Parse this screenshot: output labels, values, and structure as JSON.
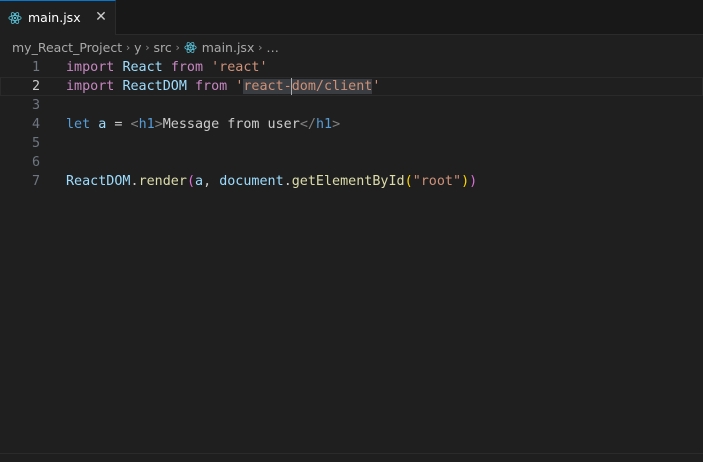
{
  "tab": {
    "label": "main.jsx",
    "icon": "react-icon",
    "close_glyph": "✕"
  },
  "breadcrumb": {
    "items": [
      "my_React_Project",
      "y",
      "src",
      "main.jsx",
      "…"
    ],
    "separator": "›"
  },
  "code": {
    "current_line": 2,
    "lines": [
      {
        "number": "1",
        "tokens": [
          {
            "t": "import",
            "c": "kw-import"
          },
          {
            "t": " ",
            "c": "plain"
          },
          {
            "t": "React",
            "c": "ident"
          },
          {
            "t": " ",
            "c": "plain"
          },
          {
            "t": "from",
            "c": "kw-import"
          },
          {
            "t": " ",
            "c": "plain"
          },
          {
            "t": "'react'",
            "c": "str"
          }
        ]
      },
      {
        "number": "2",
        "tokens": [
          {
            "t": "import",
            "c": "kw-import"
          },
          {
            "t": " ",
            "c": "plain"
          },
          {
            "t": "ReactDOM",
            "c": "ident"
          },
          {
            "t": " ",
            "c": "plain"
          },
          {
            "t": "from",
            "c": "kw-import"
          },
          {
            "t": " ",
            "c": "plain"
          },
          {
            "t": "'",
            "c": "str"
          },
          {
            "t": "react-",
            "c": "str sel"
          },
          {
            "cursor": true
          },
          {
            "t": "dom/client",
            "c": "str sel"
          },
          {
            "t": "'",
            "c": "str"
          }
        ]
      },
      {
        "number": "3",
        "tokens": []
      },
      {
        "number": "4",
        "tokens": [
          {
            "t": "let",
            "c": "kw-let"
          },
          {
            "t": " ",
            "c": "plain"
          },
          {
            "t": "a",
            "c": "ident"
          },
          {
            "t": " = ",
            "c": "plain"
          },
          {
            "t": "<",
            "c": "tag-bracket"
          },
          {
            "t": "h1",
            "c": "tag"
          },
          {
            "t": ">",
            "c": "tag-bracket"
          },
          {
            "t": "Message from user",
            "c": "jsx-text"
          },
          {
            "t": "</",
            "c": "tag-bracket"
          },
          {
            "t": "h1",
            "c": "tag"
          },
          {
            "t": ">",
            "c": "tag-bracket"
          }
        ]
      },
      {
        "number": "5",
        "tokens": []
      },
      {
        "number": "6",
        "tokens": []
      },
      {
        "number": "7",
        "tokens": [
          {
            "t": "ReactDOM",
            "c": "ident"
          },
          {
            "t": ".",
            "c": "plain"
          },
          {
            "t": "render",
            "c": "fn"
          },
          {
            "t": "(",
            "c": "paren1"
          },
          {
            "t": "a",
            "c": "ident"
          },
          {
            "t": ", ",
            "c": "plain"
          },
          {
            "t": "document",
            "c": "ident"
          },
          {
            "t": ".",
            "c": "plain"
          },
          {
            "t": "getElementById",
            "c": "fn"
          },
          {
            "t": "(",
            "c": "paren2"
          },
          {
            "t": "\"root\"",
            "c": "str"
          },
          {
            "t": ")",
            "c": "paren2"
          },
          {
            "t": ")",
            "c": "paren1"
          }
        ]
      }
    ]
  },
  "colors": {
    "background": "#1f1f1f",
    "tab_accent": "#0078d4",
    "react_icon": "#58c4dc"
  }
}
